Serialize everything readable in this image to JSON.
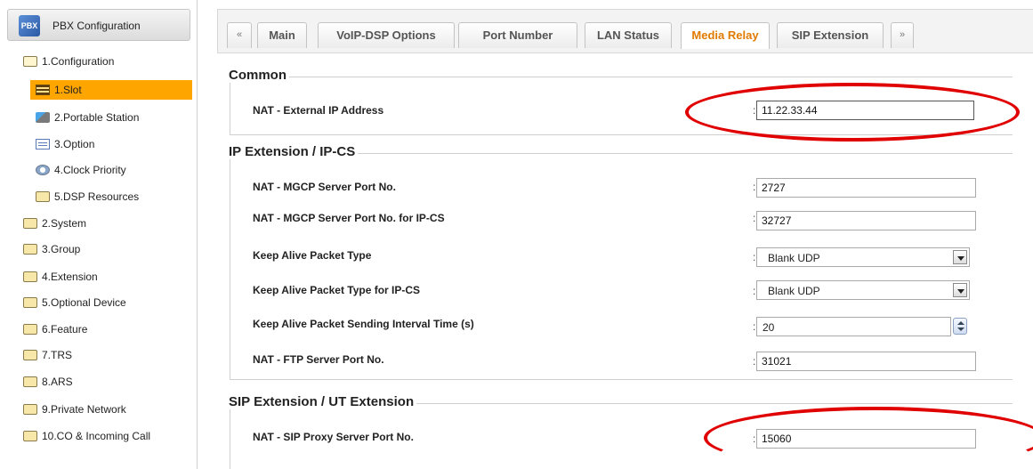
{
  "sidebar": {
    "header": "PBX Configuration",
    "logo_text": "PBX",
    "items": [
      {
        "label": "1.Configuration"
      },
      {
        "label": "1.Slot"
      },
      {
        "label": "2.Portable Station"
      },
      {
        "label": "3.Option"
      },
      {
        "label": "4.Clock Priority"
      },
      {
        "label": "5.DSP Resources"
      },
      {
        "label": "2.System"
      },
      {
        "label": "3.Group"
      },
      {
        "label": "4.Extension"
      },
      {
        "label": "5.Optional Device"
      },
      {
        "label": "6.Feature"
      },
      {
        "label": "7.TRS"
      },
      {
        "label": "8.ARS"
      },
      {
        "label": "9.Private Network"
      },
      {
        "label": "10.CO & Incoming Call"
      }
    ]
  },
  "tabs": {
    "prev": "«",
    "next": "»",
    "items": [
      "Main",
      "VoIP-DSP Options",
      "Port Number",
      "LAN Status",
      "Media Relay",
      "SIP Extension"
    ],
    "active": "Media Relay"
  },
  "sections": {
    "common": {
      "title": "Common",
      "ext_ip_label": "NAT - External IP Address",
      "ext_ip_value": "11.22.33.44"
    },
    "ip_ext": {
      "title": "IP Extension / IP-CS",
      "mgcp_port_label": "NAT - MGCP Server Port No.",
      "mgcp_port_value": "2727",
      "mgcp_port_ipcs_label": "NAT - MGCP Server Port No. for IP-CS",
      "mgcp_port_ipcs_value": "32727",
      "keepalive_type_label": "Keep Alive Packet Type",
      "keepalive_type_value": "Blank UDP",
      "keepalive_type_ipcs_label": "Keep Alive Packet Type for IP-CS",
      "keepalive_type_ipcs_value": "Blank UDP",
      "keepalive_interval_label": "Keep Alive Packet Sending Interval Time (s)",
      "keepalive_interval_value": "20",
      "ftp_port_label": "NAT - FTP Server Port No.",
      "ftp_port_value": "31021"
    },
    "sip_ext": {
      "title": "SIP Extension / UT Extension",
      "sip_proxy_port_label": "NAT - SIP Proxy Server Port No.",
      "sip_proxy_port_value": "15060"
    }
  },
  "colon": ":",
  "colors": {
    "active_tab": "#e07a00",
    "active_item": "#ffa500",
    "annotation": "#e00000"
  }
}
